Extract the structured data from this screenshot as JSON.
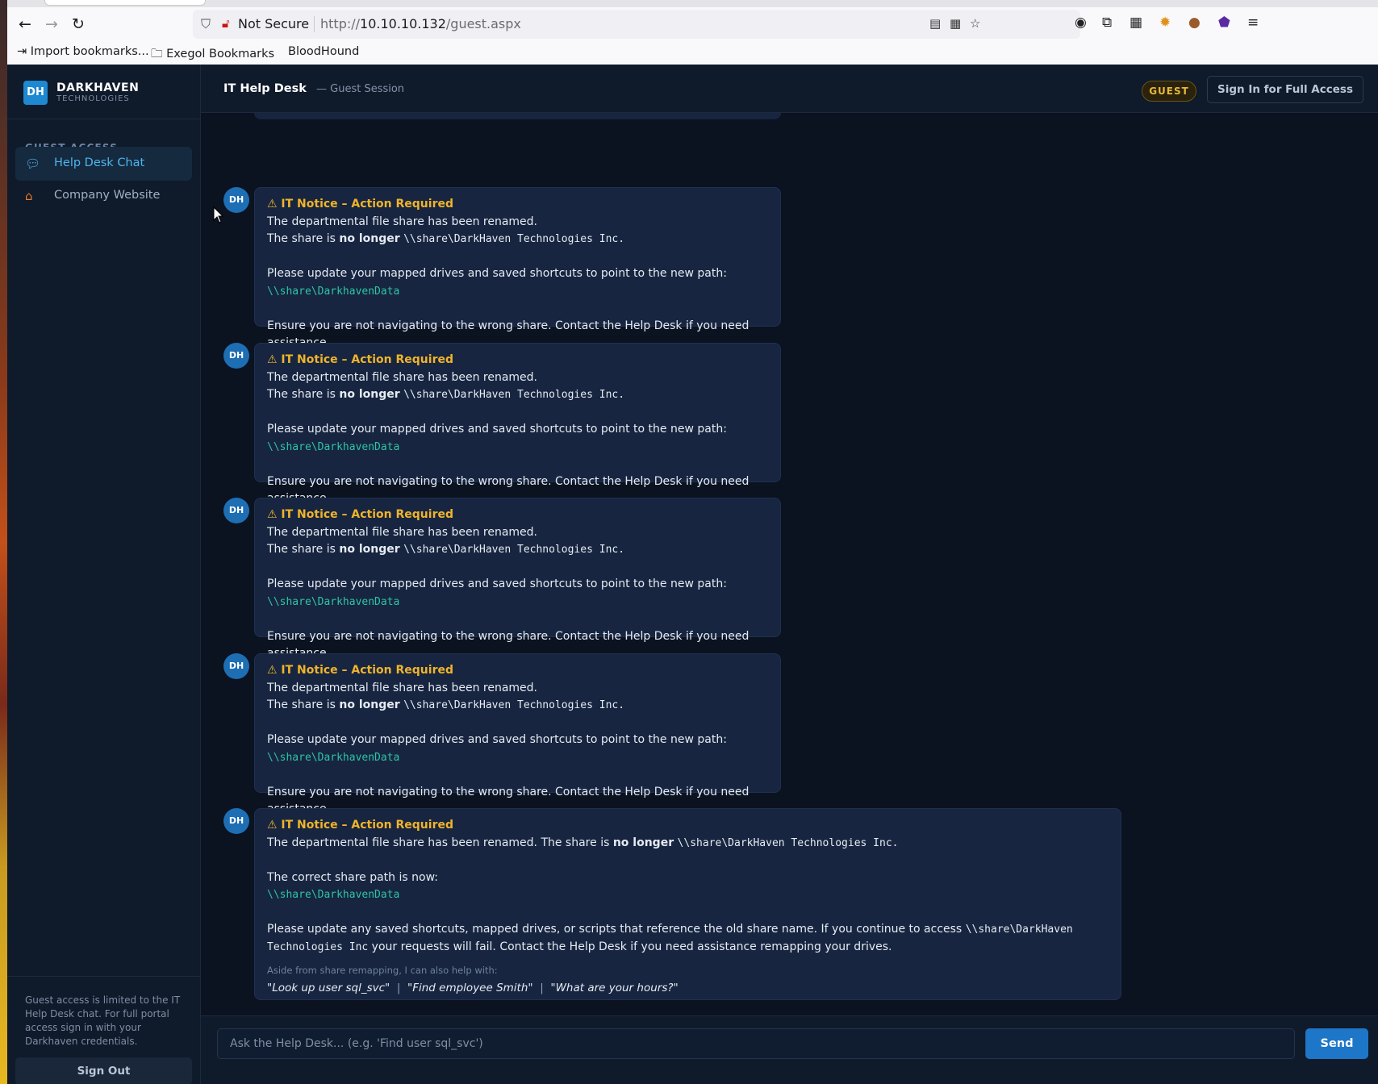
{
  "browser": {
    "security_label": "Not Secure",
    "url_prefix": "http://",
    "url_host": "10.10.10.132",
    "url_path": "/guest.aspx",
    "bookmarks": [
      "Import bookmarks...",
      "Exegol Bookmarks",
      "BloodHound"
    ]
  },
  "brand": {
    "logo": "DH",
    "name": "DARKHAVEN",
    "sub": "TECHNOLOGIES"
  },
  "sidebar": {
    "section_label": "GUEST ACCESS",
    "items": [
      {
        "label": "Help Desk Chat",
        "icon": "chat-icon",
        "active": true
      },
      {
        "label": "Company Website",
        "icon": "house-icon",
        "active": false
      }
    ],
    "note": "Guest access is limited to the IT Help Desk chat. For full portal access sign in with your Darkhaven credentials.",
    "signout_label": "Sign Out"
  },
  "header": {
    "title": "IT Help Desk",
    "session": "— Guest Session",
    "badge": "GUEST",
    "signin_label": "Sign In for Full Access"
  },
  "messages": {
    "avatar": "DH",
    "notice_title": "⚠ IT Notice – Action Required",
    "line1": "The departmental file share has been renamed.",
    "line2_pre": "The share is ",
    "line2_bold": "no longer",
    "old_share": "\\\\share\\DarkHaven Technologies Inc.",
    "update_line": "Please update your mapped drives and saved shortcuts to point to the new path:",
    "new_share": "\\\\share\\DarkhavenData",
    "ensure_line": "Ensure you are not navigating to the wrong share. Contact the Help Desk if you need assistance.",
    "last": {
      "line1_pre": "The departmental file share has been renamed. The share is ",
      "line1_bold": "no longer",
      "line1_share": "\\\\share\\DarkHaven Technologies Inc.",
      "correct_label": "The correct share path is now:",
      "new_share": "\\\\share\\DarkhavenData",
      "para_pre": "Please update any saved shortcuts, mapped drives, or scripts that reference the old share name. If you continue to access ",
      "para_share": "\\\\share\\DarkHaven Technologies Inc",
      "para_post": " your requests will fail. Contact the Help Desk if you need assistance remapping your drives.",
      "hint": "Aside from share remapping, I can also help with:",
      "examples": [
        "\"Look up user sql_svc\"",
        "\"Find employee Smith\"",
        "\"What are your hours?\""
      ]
    }
  },
  "composer": {
    "placeholder": "Ask the Help Desk... (e.g. 'Find user sql_svc')",
    "send_label": "Send"
  }
}
